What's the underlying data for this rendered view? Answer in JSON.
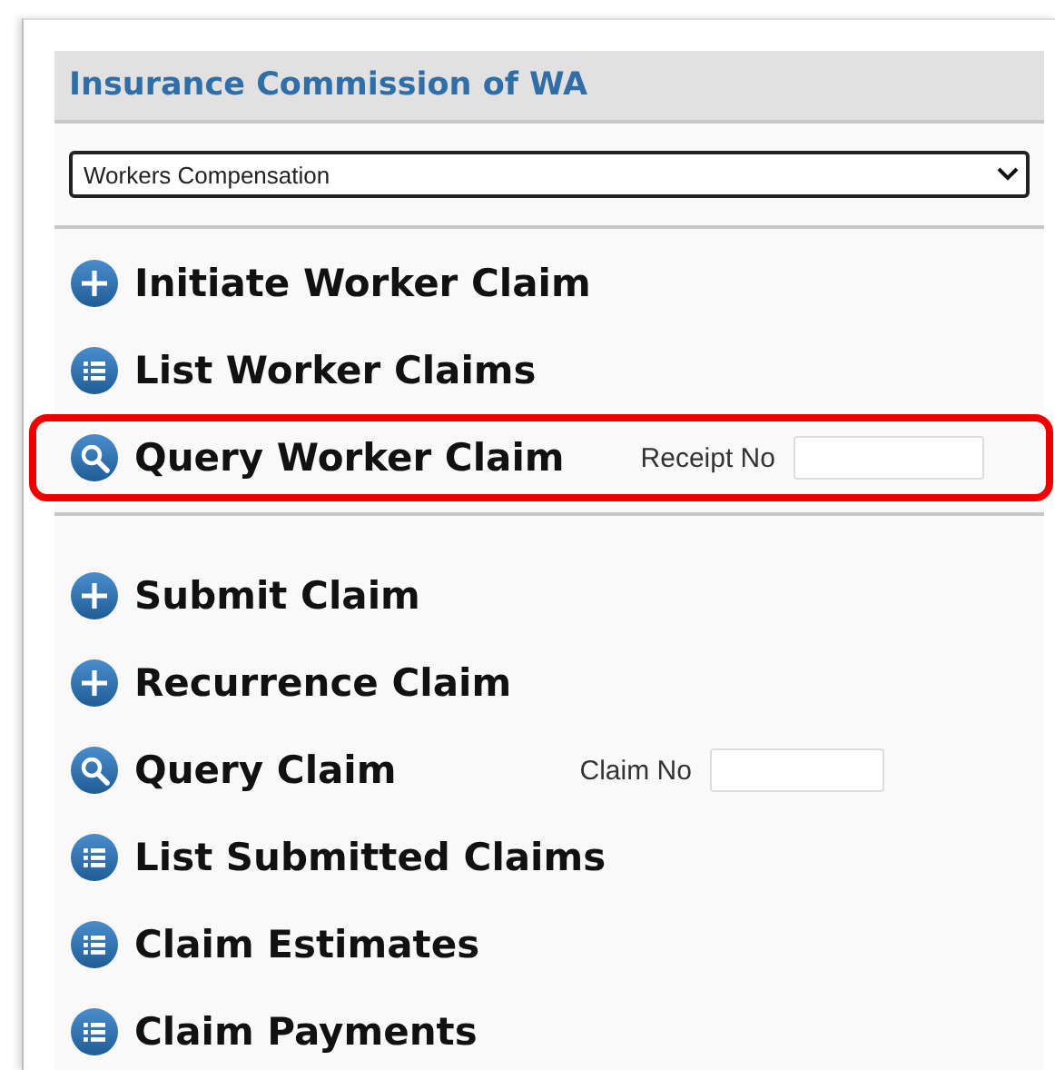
{
  "header": {
    "title": "Insurance Commission of WA"
  },
  "scheme_select": {
    "value": "Workers Compensation"
  },
  "sections": [
    {
      "items": [
        {
          "kind": "plus",
          "label": "Initiate Worker Claim",
          "highlighted": false
        },
        {
          "kind": "list",
          "label": "List Worker Claims",
          "highlighted": false
        },
        {
          "kind": "search",
          "label": "Query Worker Claim",
          "highlighted": true,
          "field_label": "Receipt No"
        }
      ]
    },
    {
      "items": [
        {
          "kind": "plus",
          "label": "Submit Claim",
          "highlighted": false
        },
        {
          "kind": "plus",
          "label": "Recurrence Claim",
          "highlighted": false
        },
        {
          "kind": "search",
          "label": "Query Claim",
          "highlighted": false,
          "field_label": "Claim No"
        },
        {
          "kind": "list",
          "label": "List Submitted Claims",
          "highlighted": false
        },
        {
          "kind": "list",
          "label": "Claim Estimates",
          "highlighted": false
        },
        {
          "kind": "list",
          "label": "Claim Payments",
          "highlighted": false
        }
      ]
    }
  ]
}
